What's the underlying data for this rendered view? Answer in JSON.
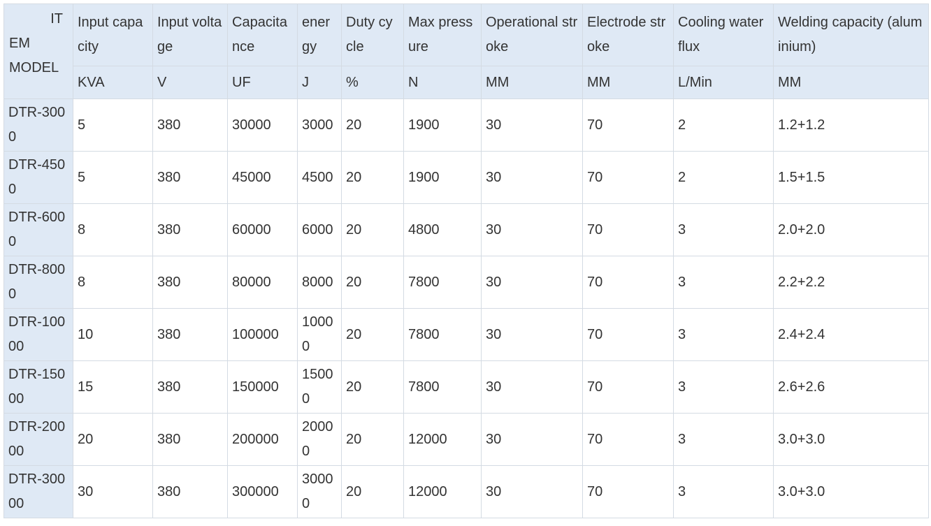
{
  "table": {
    "corner": {
      "line1": "IT",
      "line2": "EM",
      "line3": "MODEL"
    },
    "headers": [
      "Input capacity",
      "Input voltage",
      "Capacitance",
      "energy",
      "Duty cycle",
      "Max pressure",
      "Operational stroke",
      "Electrode stroke",
      "Cooling water flux",
      "Welding capacity (aluminium)"
    ],
    "units": [
      "KVA",
      "V",
      "UF",
      "J",
      "%",
      "N",
      "MM",
      "MM",
      "L/Min",
      "MM"
    ],
    "rows": [
      {
        "model": "DTR-3000",
        "cells": [
          "5",
          "380",
          "30000",
          "3000",
          "20",
          "1900",
          "30",
          "70",
          "2",
          "1.2+1.2"
        ]
      },
      {
        "model": "DTR-4500",
        "cells": [
          "5",
          "380",
          "45000",
          "4500",
          "20",
          "1900",
          "30",
          "70",
          "2",
          "1.5+1.5"
        ]
      },
      {
        "model": "DTR-6000",
        "cells": [
          "8",
          "380",
          "60000",
          "6000",
          "20",
          "4800",
          "30",
          "70",
          "3",
          "2.0+2.0"
        ]
      },
      {
        "model": "DTR-8000",
        "cells": [
          "8",
          "380",
          "80000",
          "8000",
          "20",
          "7800",
          "30",
          "70",
          "3",
          "2.2+2.2"
        ]
      },
      {
        "model": "DTR-10000",
        "cells": [
          "10",
          "380",
          "100000",
          "10000",
          "20",
          "7800",
          "30",
          "70",
          "3",
          "2.4+2.4"
        ]
      },
      {
        "model": "DTR-15000",
        "cells": [
          "15",
          "380",
          "150000",
          "15000",
          "20",
          "7800",
          "30",
          "70",
          "3",
          "2.6+2.6"
        ]
      },
      {
        "model": "DTR-20000",
        "cells": [
          "20",
          "380",
          "200000",
          "20000",
          "20",
          "12000",
          "30",
          "70",
          "3",
          "3.0+3.0"
        ]
      },
      {
        "model": "DTR-30000",
        "cells": [
          "30",
          "380",
          "300000",
          "30000",
          "20",
          "12000",
          "30",
          "70",
          "3",
          "3.0+3.0"
        ]
      }
    ]
  }
}
